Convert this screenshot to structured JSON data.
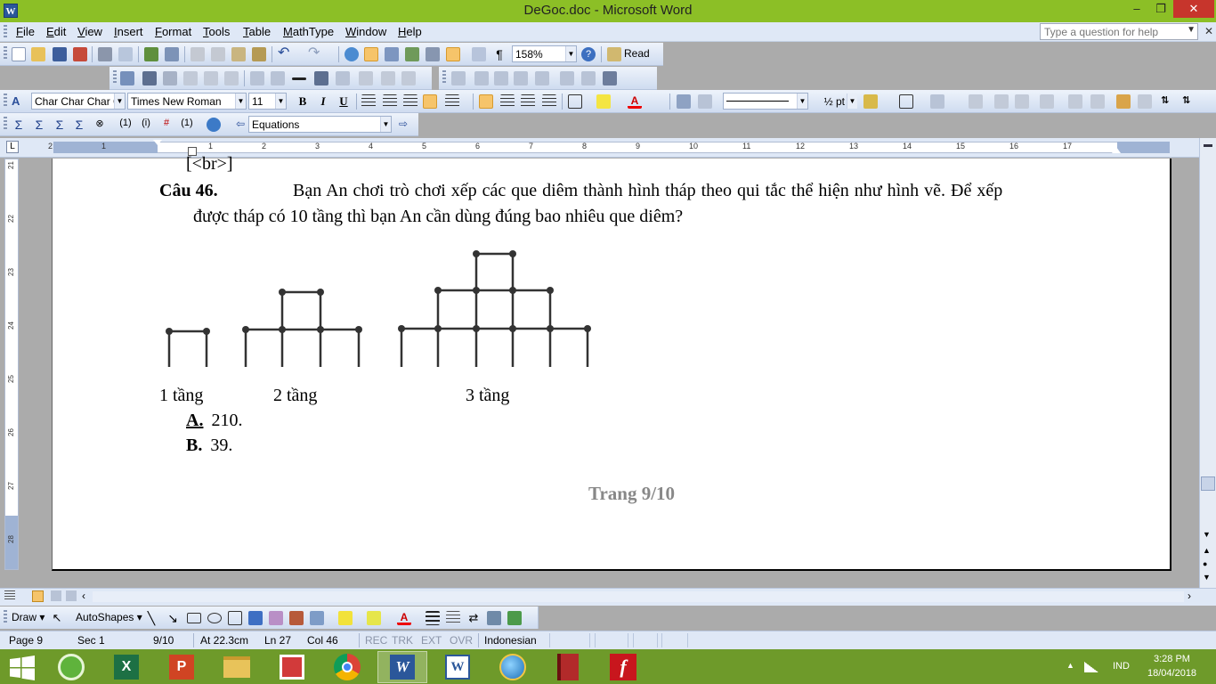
{
  "window": {
    "title": "DeGoc.doc - Microsoft Word"
  },
  "menu": {
    "items": [
      "File",
      "Edit",
      "View",
      "Insert",
      "Format",
      "Tools",
      "Table",
      "MathType",
      "Window",
      "Help"
    ],
    "help_placeholder": "Type a question for help"
  },
  "toolbar": {
    "zoom": "158%",
    "read_label": "Read",
    "style": "Char Char Char C",
    "font": "Times New Roman",
    "size": "11",
    "bold": "B",
    "italic": "I",
    "underline": "U",
    "line_weight": "½ pt",
    "equations_combo": "Equations"
  },
  "ruler": {
    "marks": [
      "2",
      "1",
      "1",
      "2",
      "3",
      "4",
      "5",
      "6",
      "7",
      "8",
      "9",
      "10",
      "11",
      "12",
      "13",
      "14",
      "15",
      "16",
      "17"
    ]
  },
  "vruler": {
    "marks": [
      "21",
      "22",
      "23",
      "24",
      "25",
      "26",
      "27",
      "28"
    ]
  },
  "document": {
    "br_tag": "[<br>]",
    "question_label": "Câu 46.",
    "question_text": "Bạn An chơi trò chơi xếp các que diêm thành hình tháp theo qui tắc thể hiện như hình vẽ. Để xếp",
    "question_text_2": "được tháp có 10 tầng thì bạn An cần dùng đúng bao nhiêu que diêm?",
    "figure_labels": [
      "1 tầng",
      "2 tầng",
      "3 tầng"
    ],
    "options": [
      {
        "letter": "A.",
        "value": "210."
      },
      {
        "letter": "B.",
        "value": "39."
      }
    ],
    "page_footer": "Trang 9/10"
  },
  "drawbar": {
    "draw_label": "Draw",
    "autoshapes_label": "AutoShapes"
  },
  "status": {
    "page": "Page 9",
    "sec": "Sec 1",
    "pages": "9/10",
    "at": "At 22.3cm",
    "ln": "Ln 27",
    "col": "Col 46",
    "rec": "REC",
    "trk": "TRK",
    "ext": "EXT",
    "ovr": "OVR",
    "language": "Indonesian"
  },
  "taskbar": {
    "lang": "IND",
    "time": "3:28 PM",
    "date": "18/04/2018"
  }
}
